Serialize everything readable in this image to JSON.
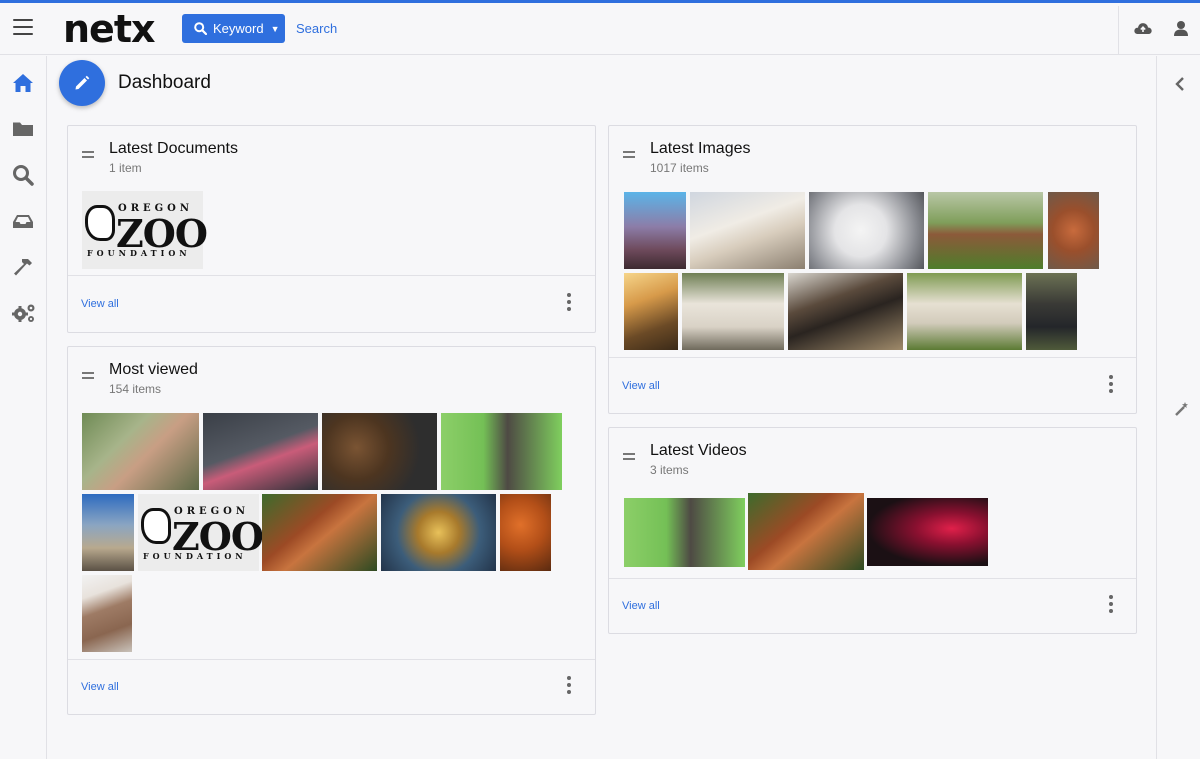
{
  "header": {
    "logo_text": "netx",
    "keyword_button_label": "Keyword",
    "search_placeholder": "Search"
  },
  "nav": {
    "items": [
      "home-icon",
      "folder-icon",
      "search-icon",
      "inbox-icon",
      "hammer-icon",
      "gears-icon"
    ]
  },
  "page": {
    "title": "Dashboard"
  },
  "cards": {
    "latest_documents": {
      "title": "Latest Documents",
      "count": "1 item",
      "view_all": "View all"
    },
    "most_viewed": {
      "title": "Most viewed",
      "count": "154 items",
      "view_all": "View all"
    },
    "latest_images": {
      "title": "Latest Images",
      "count": "1017 items",
      "view_all": "View all"
    },
    "latest_videos": {
      "title": "Latest Videos",
      "count": "3 items",
      "view_all": "View all"
    }
  },
  "logo_tile": {
    "oregon": "OREGON",
    "zoo": "ZOO",
    "foundation": "FOUNDATION"
  },
  "colors": {
    "accent": "#2f6fde",
    "background": "#f7f7f9"
  }
}
